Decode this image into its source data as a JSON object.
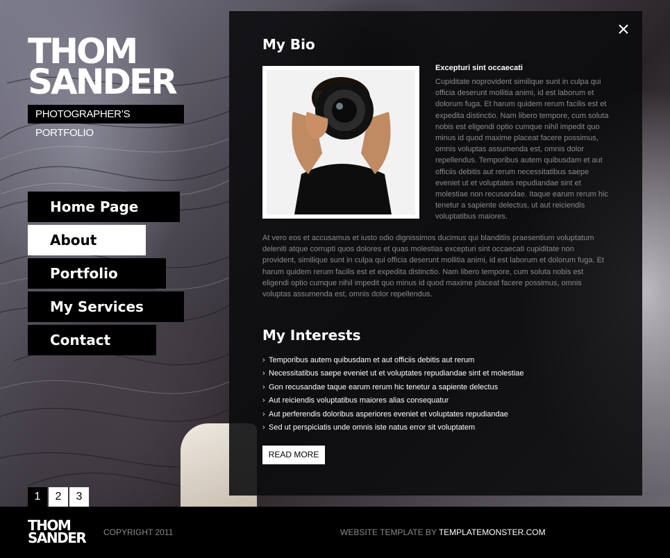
{
  "brand": {
    "name_line1": "THOM",
    "name_line2": "SANDER",
    "tagline": "PHOTOGRAPHER’S PORTFOLIO"
  },
  "nav": {
    "items": [
      {
        "label": "Home Page"
      },
      {
        "label": "About"
      },
      {
        "label": "Portfolio"
      },
      {
        "label": "My Services"
      },
      {
        "label": "Contact"
      }
    ],
    "active": "About"
  },
  "pager": {
    "pages": [
      "1",
      "2",
      "3"
    ],
    "current": "1"
  },
  "bio": {
    "title": "My Bio",
    "subtitle": "Excepturi sint occaecati",
    "side_text": "Cupiditate noprovident similique sunt in culpa qui officia deserunt mollitia animi, id est laborum et dolorum fuga. Et harum quidem rerum facilis est et expedita distinctio. Nam libero tempore, cum soluta nobis est eligendi optio cumque nihil impedit quo minus id quod maxime placeat facere possimus, omnis voluptas assumenda est, omnis dolor repellendus. Temporibus autem quibusdam et aut officiis debitis aut rerum necessitatibus saepe eveniet ut et voluptates repudiandae sint et molestiae non recusandae. Itaque earum rerum hic tenetur a sapiente delectus, ut aut reiciendis voluptatibus maiores.",
    "full_text": "At vero eos et accusamus et iusto odio dignissimos ducimus qui blanditiis praesentium voluptatum deleniti atque corrupti quos dolores et quas molestias excepturi sint occaecati cupiditate non provident, similique sunt in culpa qui officia deserunt mollitia animi, id est laborum et dolorum fuga. Et harum quidem rerum facilis est et expedita distinctio. Nam libero tempore, cum soluta nobis est eligendi optio cumque nihil impedit quo minus id quod maxime placeat facere possimus, omnis voluptas assumenda est, omnis dolor repellendus."
  },
  "interests": {
    "title": "My Interests",
    "items": [
      "Temporibus autem quibusdam et aut officiis debitis aut rerum",
      "Necessitatibus saepe eveniet ut et voluptates repudiandae sint et molestiae",
      "Gon recusandae taque earum rerum hic tenetur a sapiente delectus",
      "Aut reiciendis voluptatibus maiores alias consequatur",
      "Aut perferendis doloribus asperiores eveniet et voluptates repudiandae",
      "Sed ut perspiciatis unde omnis iste natus error sit voluptatem"
    ],
    "read_more": "READ MORE"
  },
  "footer": {
    "logo_line1": "THOM",
    "logo_line2": "SANDER",
    "copyright": "COPYRIGHT 2011",
    "credit_prefix": "WEBSITE TEMPLATE BY ",
    "credit_link": "TEMPLATEMONSTER.COM"
  },
  "icons": {
    "close": "close-icon",
    "bullet": "chevron-right-icon"
  }
}
